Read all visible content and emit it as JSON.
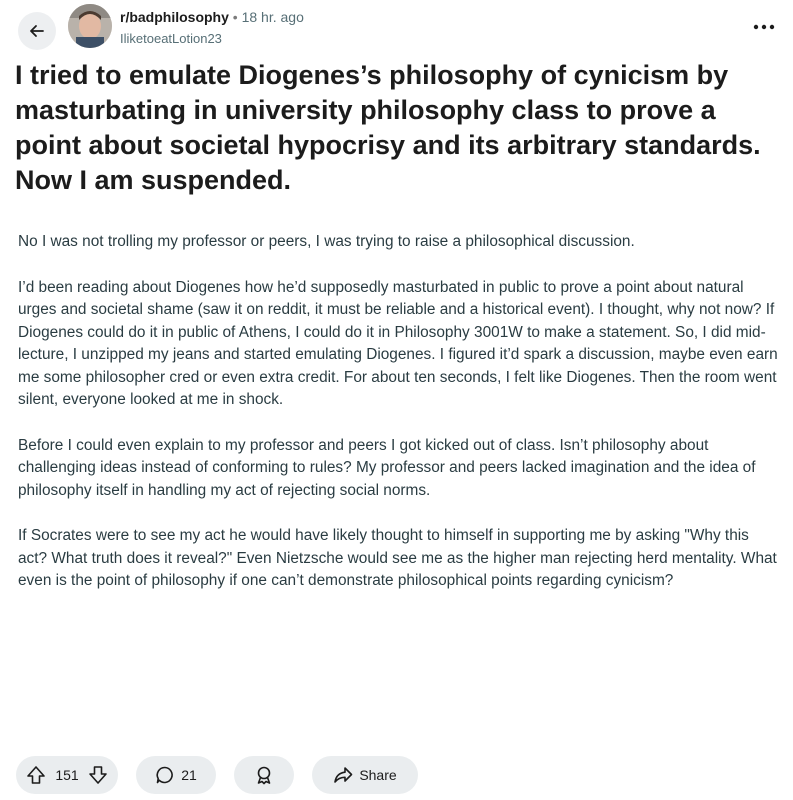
{
  "post": {
    "subreddit": "r/badphilosophy",
    "separator": "•",
    "time": "18 hr. ago",
    "username": "IliketoeatLotion23",
    "title": "I tried to emulate Diogenes’s philosophy of cynicism by masturbating in university philosophy class to prove a point about societal hypocrisy and its arbitrary standards. Now I am suspended.",
    "paragraphs": [
      "No I was not trolling my professor or peers, I was trying to raise a philosophical discussion.",
      "I’d been reading about Diogenes how he’d supposedly masturbated in public to prove a point about natural urges and societal shame (saw it on reddit, it must be reliable and a historical event). I thought, why not now? If Diogenes could do it in public of Athens, I could do it in Philosophy 3001W to make a statement. So, I did mid-lecture, I unzipped my jeans and started emulating Diogenes. I figured it’d spark a discussion, maybe even earn me some philosopher cred or even extra credit. For about ten seconds, I felt like Diogenes. Then the room went silent, everyone looked at me in shock.",
      "Before I could even explain to my professor and peers I got kicked out of class. Isn’t philosophy about challenging ideas instead of conforming to rules? My professor and peers lacked imagination and the idea of philosophy itself in handling my act of rejecting social norms.",
      "If Socrates were to see my act he would have likely thought to himself in supporting me by asking \"Why this act? What truth does it reveal?\" Even Nietzsche would see me as the higher man rejecting herd mentality. What even is the point of philosophy if one can’t demonstrate philosophical points regarding cynicism?"
    ]
  },
  "actions": {
    "upvotes": "151",
    "comments": "21",
    "share_label": "Share"
  },
  "icons": {
    "back": "back-arrow-icon",
    "more": "more-options-icon",
    "upvote": "upvote-icon",
    "downvote": "downvote-icon",
    "comment": "comment-icon",
    "award": "award-icon",
    "share": "share-icon"
  }
}
